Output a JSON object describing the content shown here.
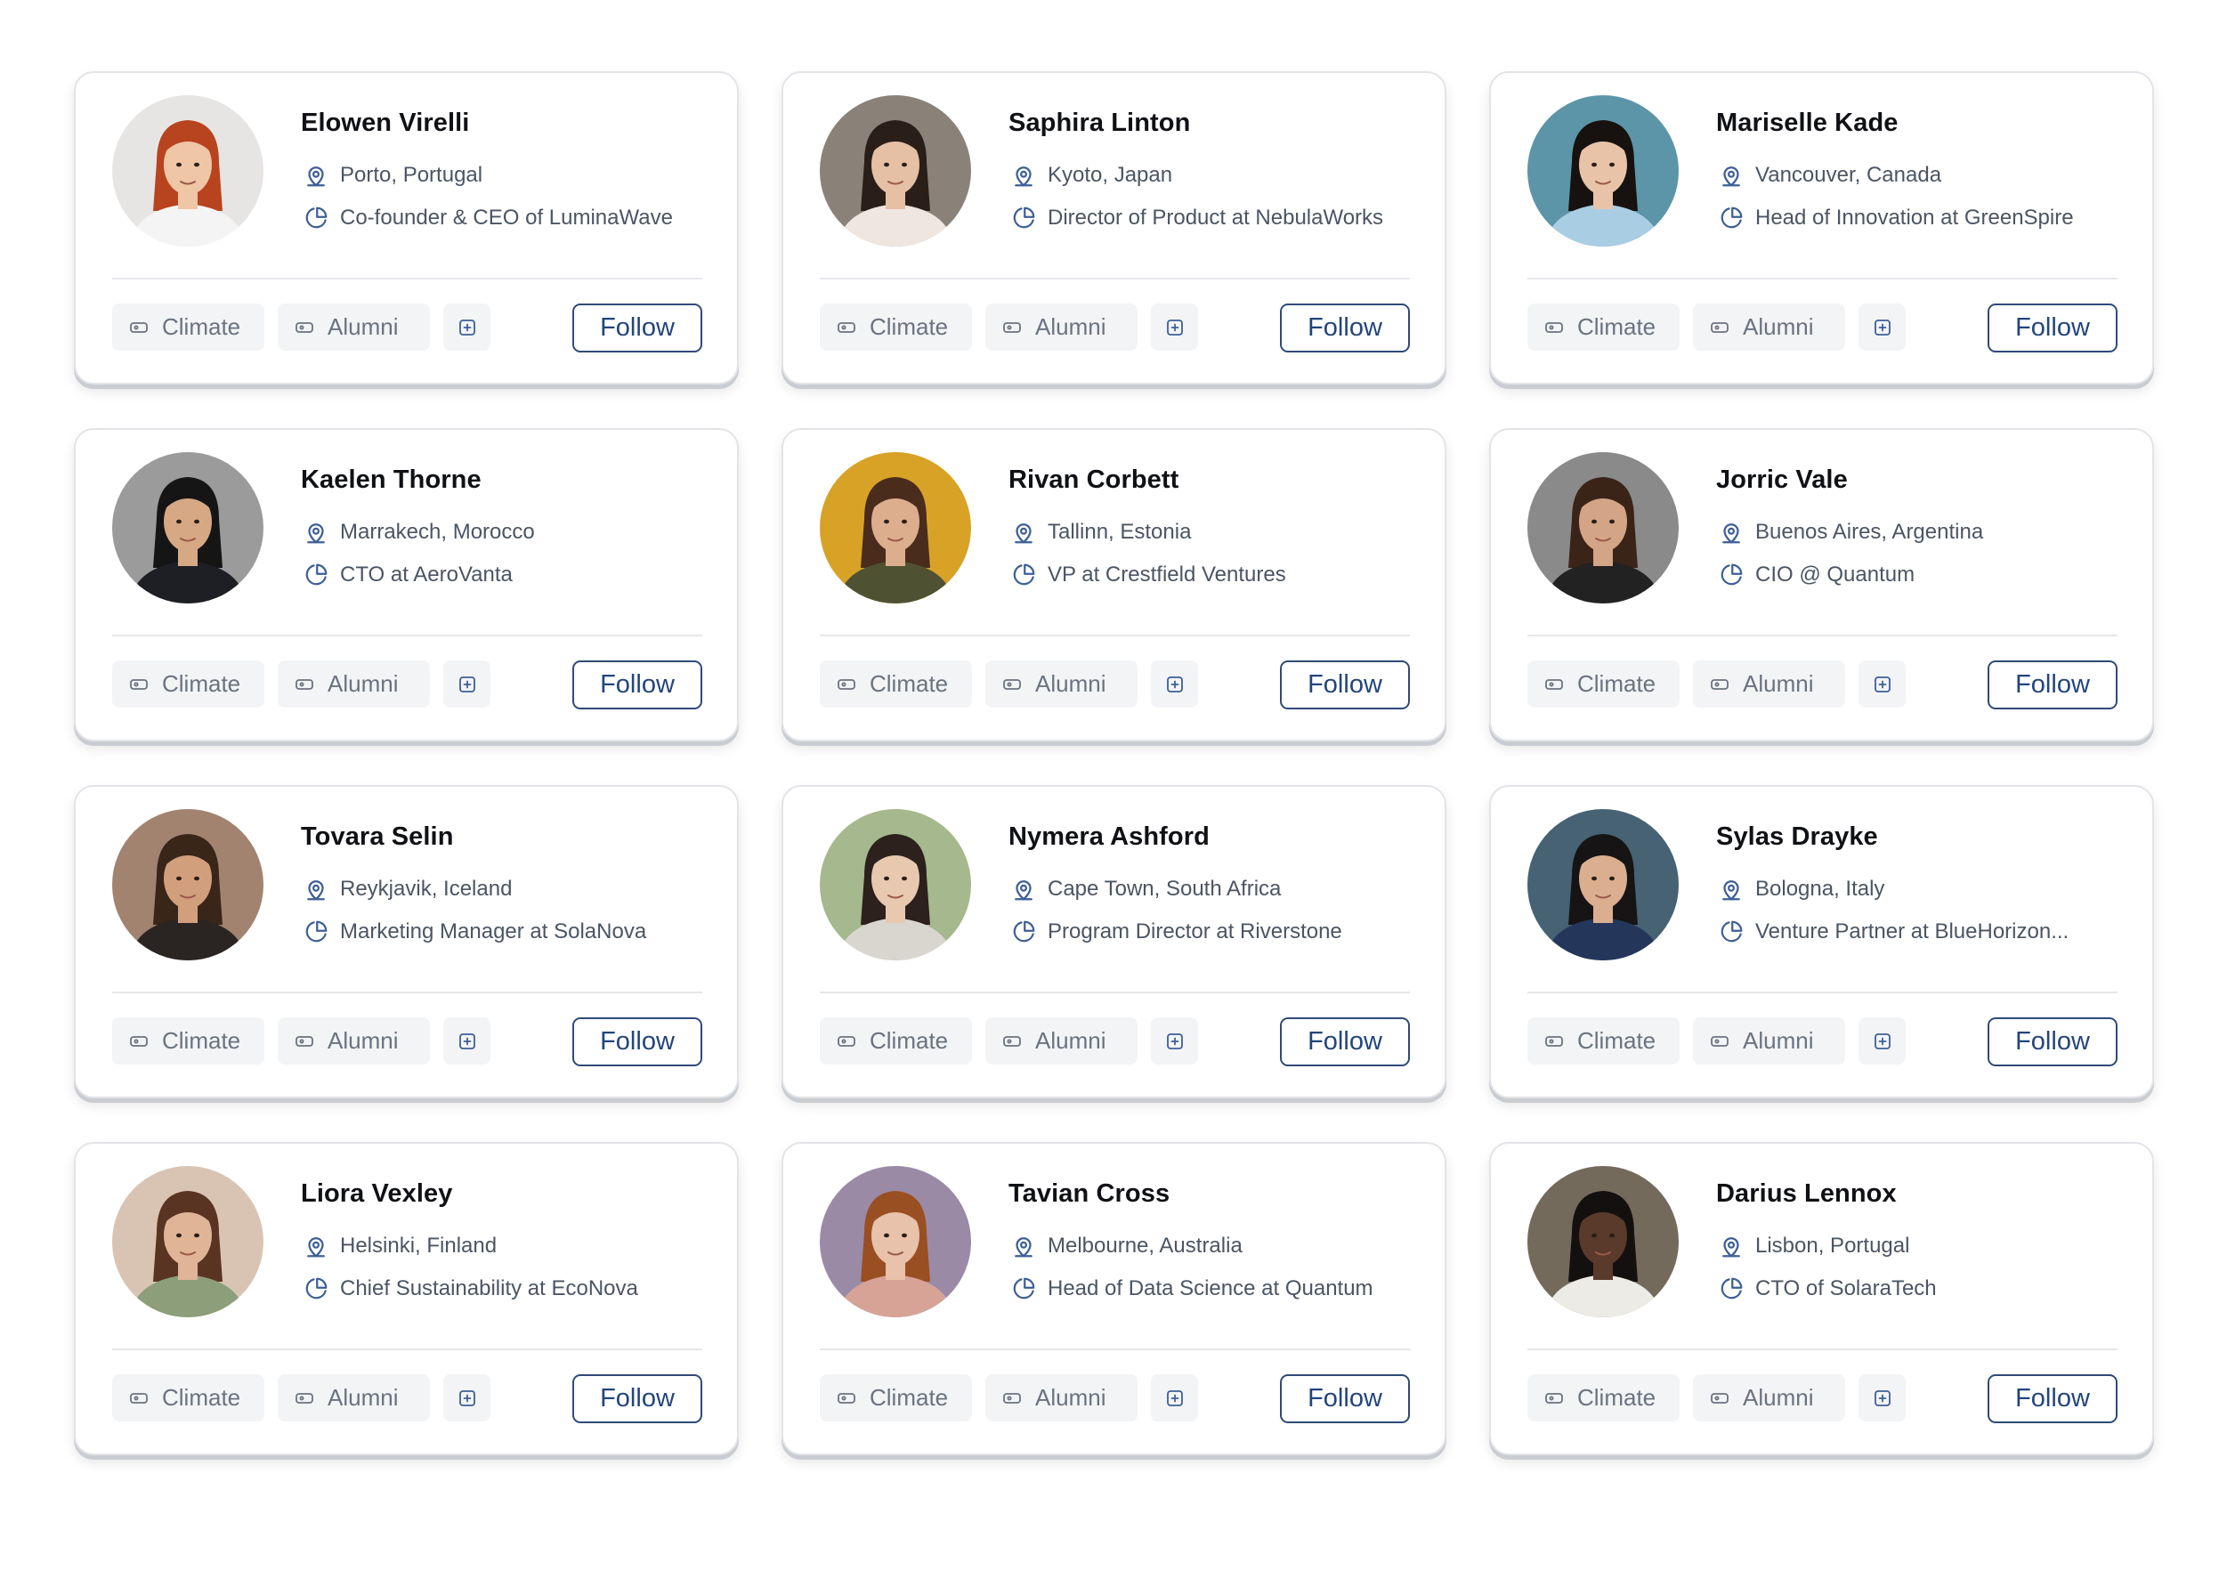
{
  "tags": {
    "tag1": "Climate",
    "tag2": "Alumni"
  },
  "follow_label": "Follow",
  "colors": {
    "accent": "#23457c",
    "icon": "#3d5f96",
    "tag_bg": "#f3f4f6",
    "border": "#e2e4e8"
  },
  "icons": {
    "location": "map-pin-icon",
    "role": "pie-chart-icon",
    "tag": "tag-icon",
    "add": "plus-square-icon"
  },
  "profiles": [
    {
      "name": "Elowen Virelli",
      "location": "Porto, Portugal",
      "role": "Co-founder & CEO of LuminaWave",
      "avatar": {
        "bg": "#e7e5e3",
        "skin": "#efc6a6",
        "hair": "#b8431f",
        "shirt": "#f4f4f4"
      }
    },
    {
      "name": "Saphira Linton",
      "location": "Kyoto, Japan",
      "role": "Director of Product at NebulaWorks",
      "avatar": {
        "bg": "#8a8178",
        "skin": "#e6c0a5",
        "hair": "#2a1e19",
        "shirt": "#efe7df"
      }
    },
    {
      "name": "Mariselle Kade",
      "location": "Vancouver, Canada",
      "role": "Head of Innovation at GreenSpire",
      "avatar": {
        "bg": "#5c95a8",
        "skin": "#e9c3a8",
        "hair": "#17120f",
        "shirt": "#a9cde3"
      }
    },
    {
      "name": "Kaelen Thorne",
      "location": "Marrakech, Morocco",
      "role": "CTO at AeroVanta",
      "avatar": {
        "bg": "#9b9b9b",
        "skin": "#d6a884",
        "hair": "#151515",
        "shirt": "#1d1f24"
      }
    },
    {
      "name": "Rivan Corbett",
      "location": "Tallinn, Estonia",
      "role": "VP at Crestfield Ventures",
      "avatar": {
        "bg": "#d8a226",
        "skin": "#dcae8e",
        "hair": "#4a2c1d",
        "shirt": "#4f5232"
      }
    },
    {
      "name": "Jorric Vale",
      "location": "Buenos Aires, Argentina",
      "role": "CIO @ Quantum",
      "avatar": {
        "bg": "#8a8a8a",
        "skin": "#d3a486",
        "hair": "#3a2418",
        "shirt": "#222222"
      }
    },
    {
      "name": "Tovara Selin",
      "location": "Reykjavik, Iceland",
      "role": "Marketing Manager at SolaNova",
      "avatar": {
        "bg": "#a1836f",
        "skin": "#d29f7d",
        "hair": "#3a2519",
        "shirt": "#2a2523"
      }
    },
    {
      "name": "Nymera Ashford",
      "location": "Cape Town, South Africa",
      "role": "Program Director at Riverstone",
      "avatar": {
        "bg": "#a6b88d",
        "skin": "#e8c9b0",
        "hair": "#2c211c",
        "shirt": "#d9d5cf"
      }
    },
    {
      "name": "Sylas Drayke",
      "location": "Bologna, Italy",
      "role": "Venture Partner at BlueHorizon...",
      "avatar": {
        "bg": "#466273",
        "skin": "#dcae90",
        "hair": "#161414",
        "shirt": "#24375a"
      }
    },
    {
      "name": "Liora Vexley",
      "location": "Helsinki, Finland",
      "role": "Chief Sustainability at EcoNova",
      "avatar": {
        "bg": "#d9c4b3",
        "skin": "#e0b497",
        "hair": "#5a3422",
        "shirt": "#8c9e7a"
      }
    },
    {
      "name": "Tavian Cross",
      "location": "Melbourne, Australia",
      "role": "Head of Data Science at Quantum",
      "avatar": {
        "bg": "#9a8aa6",
        "skin": "#e8c2ab",
        "hair": "#9a4f22",
        "shirt": "#d7a397"
      }
    },
    {
      "name": "Darius Lennox",
      "location": "Lisbon, Portugal",
      "role": "CTO of SolaraTech",
      "avatar": {
        "bg": "#746a5c",
        "skin": "#5a3a2a",
        "hair": "#151010",
        "shirt": "#ecebe6"
      }
    }
  ]
}
